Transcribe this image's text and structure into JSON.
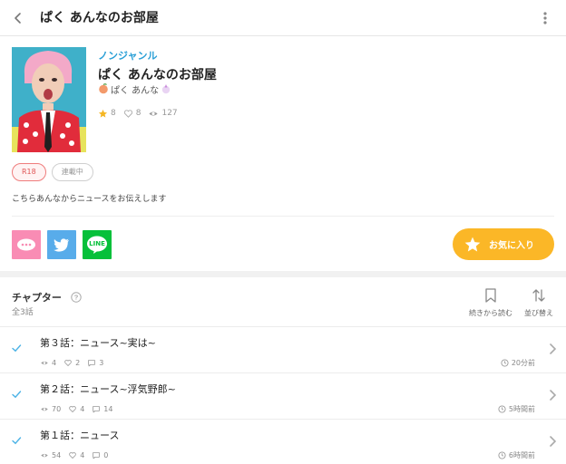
{
  "header": {
    "title": "ぱく あんなのお部屋"
  },
  "work": {
    "genre": "ノンジャンル",
    "title": "ぱく あんなのお部屋",
    "author": "ぱく あんな",
    "stars": "8",
    "likes": "8",
    "views": "127",
    "badges": {
      "rating": "R18",
      "status": "連載中"
    },
    "description": "こちらあんなからニュースをお伝えします"
  },
  "share": [
    {
      "name": "moonmoon-share",
      "icon": "speech-bubble-icon",
      "color": "#f98cb4"
    },
    {
      "name": "twitter-share",
      "icon": "twitter-bird-icon",
      "color": "#58acea"
    },
    {
      "name": "line-share",
      "icon": "line-icon",
      "label": "LINE",
      "color": "#06c03a"
    }
  ],
  "favorite": {
    "label": "お気に入り",
    "color": "#fbb727"
  },
  "chapters_section": {
    "heading": "チャプター",
    "count": "全3話",
    "continue_label": "続きから読む",
    "sort_label": "並び替え"
  },
  "chapters": [
    {
      "title": "第３話：ニュース~実は~",
      "views": "4",
      "likes": "2",
      "comments": "3",
      "time": "20分前"
    },
    {
      "title": "第２話：ニュース~浮気野郎~",
      "views": "70",
      "likes": "4",
      "comments": "14",
      "time": "5時間前"
    },
    {
      "title": "第１話：ニュース",
      "views": "54",
      "likes": "4",
      "comments": "0",
      "time": "6時間前"
    }
  ],
  "colors": {
    "accent_blue": "#2a9fd6",
    "check": "#4db3e6",
    "star": "#f5b623"
  }
}
